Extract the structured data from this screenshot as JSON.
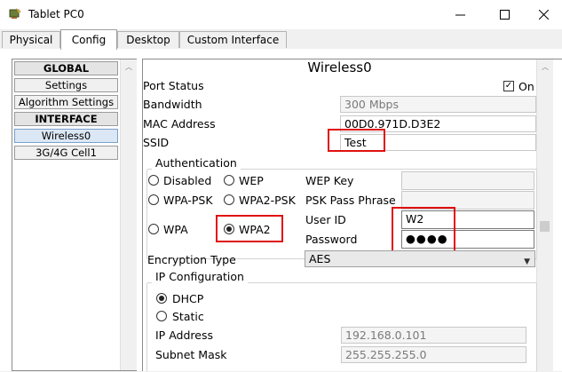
{
  "window": {
    "title": "Tablet PC0"
  },
  "tabs": [
    {
      "label": "Physical"
    },
    {
      "label": "Config"
    },
    {
      "label": "Desktop"
    },
    {
      "label": "Custom Interface"
    }
  ],
  "nav": {
    "global_header": "GLOBAL",
    "settings": "Settings",
    "algorithm_settings": "Algorithm Settings",
    "interface_header": "INTERFACE",
    "wireless0": "Wireless0",
    "cell": "3G/4G Cell1"
  },
  "pane": {
    "title": "Wireless0",
    "port_status_label": "Port Status",
    "port_on_label": "On",
    "port_on_checked": true,
    "bandwidth_label": "Bandwidth",
    "bandwidth_value": "300 Mbps",
    "mac_label": "MAC Address",
    "mac_value": "00D0.971D.D3E2",
    "ssid_label": "SSID",
    "ssid_value": "Test"
  },
  "auth": {
    "legend": "Authentication",
    "disabled": "Disabled",
    "wep": "WEP",
    "wep_key_label": "WEP Key",
    "wpa_psk": "WPA-PSK",
    "wpa2_psk": "WPA2-PSK",
    "psk_pass_label": "PSK Pass Phrase",
    "wpa": "WPA",
    "wpa2": "WPA2",
    "selected": "WPA2",
    "user_id_label": "User ID",
    "user_id_value": "W2",
    "password_label": "Password",
    "password_value": "●●●●",
    "encryption_label": "Encryption Type",
    "encryption_value": "AES"
  },
  "ip": {
    "legend": "IP Configuration",
    "dhcp": "DHCP",
    "static": "Static",
    "selected": "DHCP",
    "ip_label": "IP Address",
    "ip_value": "192.168.0.101",
    "mask_label": "Subnet Mask",
    "mask_value": "255.255.255.0"
  },
  "colors": {
    "highlight": "#e01010",
    "window_bg": "#f0f0f0"
  }
}
